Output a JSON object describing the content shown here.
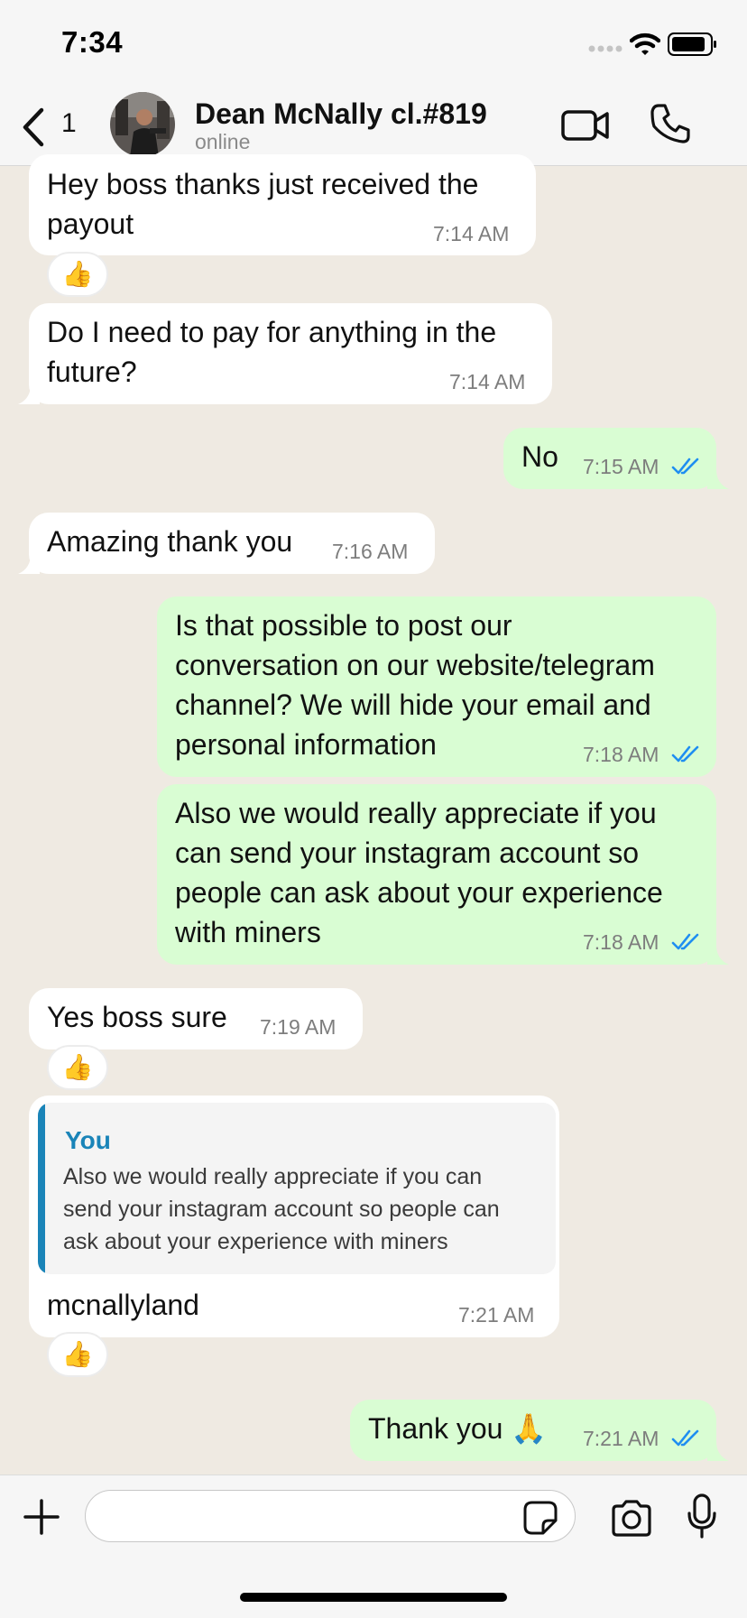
{
  "status_bar": {
    "time": "7:34"
  },
  "header": {
    "back_count": "1",
    "contact_name": "Dean McNally cl.#819",
    "contact_status": "online"
  },
  "messages": [
    {
      "dir": "in",
      "lines": [
        "Hey boss thanks just received the",
        "payout"
      ],
      "time": "7:14 AM",
      "reaction": "👍"
    },
    {
      "dir": "in",
      "lines": [
        "Do I need to pay for anything in the",
        "future?"
      ],
      "time": "7:14 AM"
    },
    {
      "dir": "out",
      "lines": [
        "No"
      ],
      "time": "7:15 AM",
      "status": "read"
    },
    {
      "dir": "in",
      "lines": [
        "Amazing thank you"
      ],
      "time": "7:16 AM"
    },
    {
      "dir": "out",
      "lines": [
        "Is that possible to post our",
        "conversation on our website/telegram",
        "channel? We will hide your email and",
        "personal information"
      ],
      "time": "7:18 AM",
      "status": "read"
    },
    {
      "dir": "out",
      "lines": [
        "Also we would really appreciate if you",
        "can send your instagram account so",
        "people can ask about your experience",
        "with miners"
      ],
      "time": "7:18 AM",
      "status": "read"
    },
    {
      "dir": "in",
      "lines": [
        "Yes boss sure"
      ],
      "time": "7:19 AM",
      "reaction": "👍"
    },
    {
      "dir": "in",
      "quote": {
        "author": "You",
        "lines": [
          "Also we would really appreciate if you can",
          "send your instagram account so people can",
          "ask about your experience with miners"
        ]
      },
      "lines": [
        "mcnallyland"
      ],
      "time": "7:21 AM",
      "reaction": "👍"
    },
    {
      "dir": "out",
      "lines": [
        "Thank you 🙏"
      ],
      "time": "7:21 AM",
      "status": "read"
    }
  ],
  "input": {
    "placeholder": ""
  },
  "colors": {
    "incoming": "#ffffff",
    "outgoing": "#d9fdd3",
    "read_tick": "#1f8ef1",
    "quote_accent": "#1a84b8"
  },
  "icons": [
    "chevron-left-icon",
    "video-camera-icon",
    "phone-icon",
    "plus-icon",
    "sticker-icon",
    "camera-icon",
    "microphone-icon",
    "wifi-icon",
    "battery-icon",
    "double-check-icon"
  ]
}
